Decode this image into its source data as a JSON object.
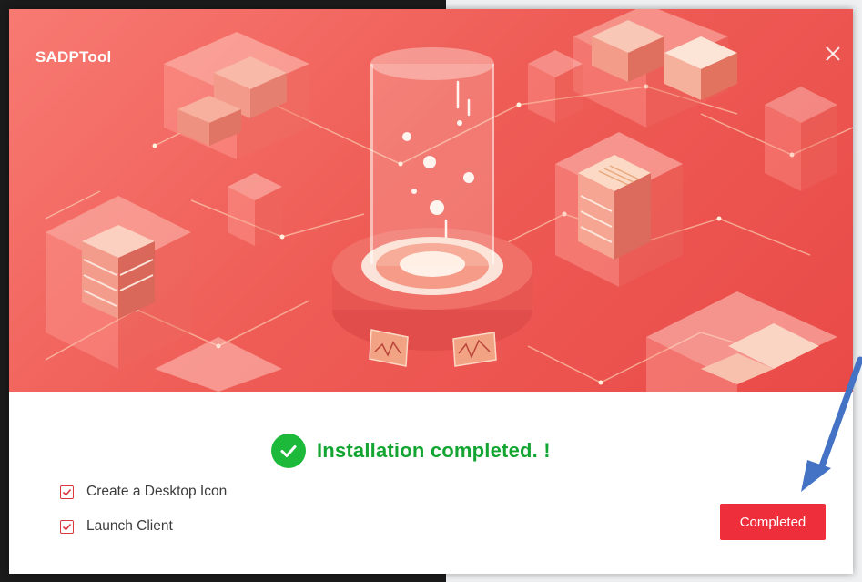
{
  "window": {
    "title": "SADPTool",
    "close_icon": "close-icon"
  },
  "status": {
    "icon": "check-circle-icon",
    "text": "Installation completed. !"
  },
  "options": [
    {
      "label": "Create a Desktop Icon",
      "checked": true
    },
    {
      "label": "Launch Client",
      "checked": true
    }
  ],
  "buttons": {
    "complete_label": "Completed"
  },
  "colors": {
    "accent": "#ee2f3b",
    "success": "#13a531",
    "banner": "#ef5d57",
    "annotation_arrow": "#4472c4"
  }
}
